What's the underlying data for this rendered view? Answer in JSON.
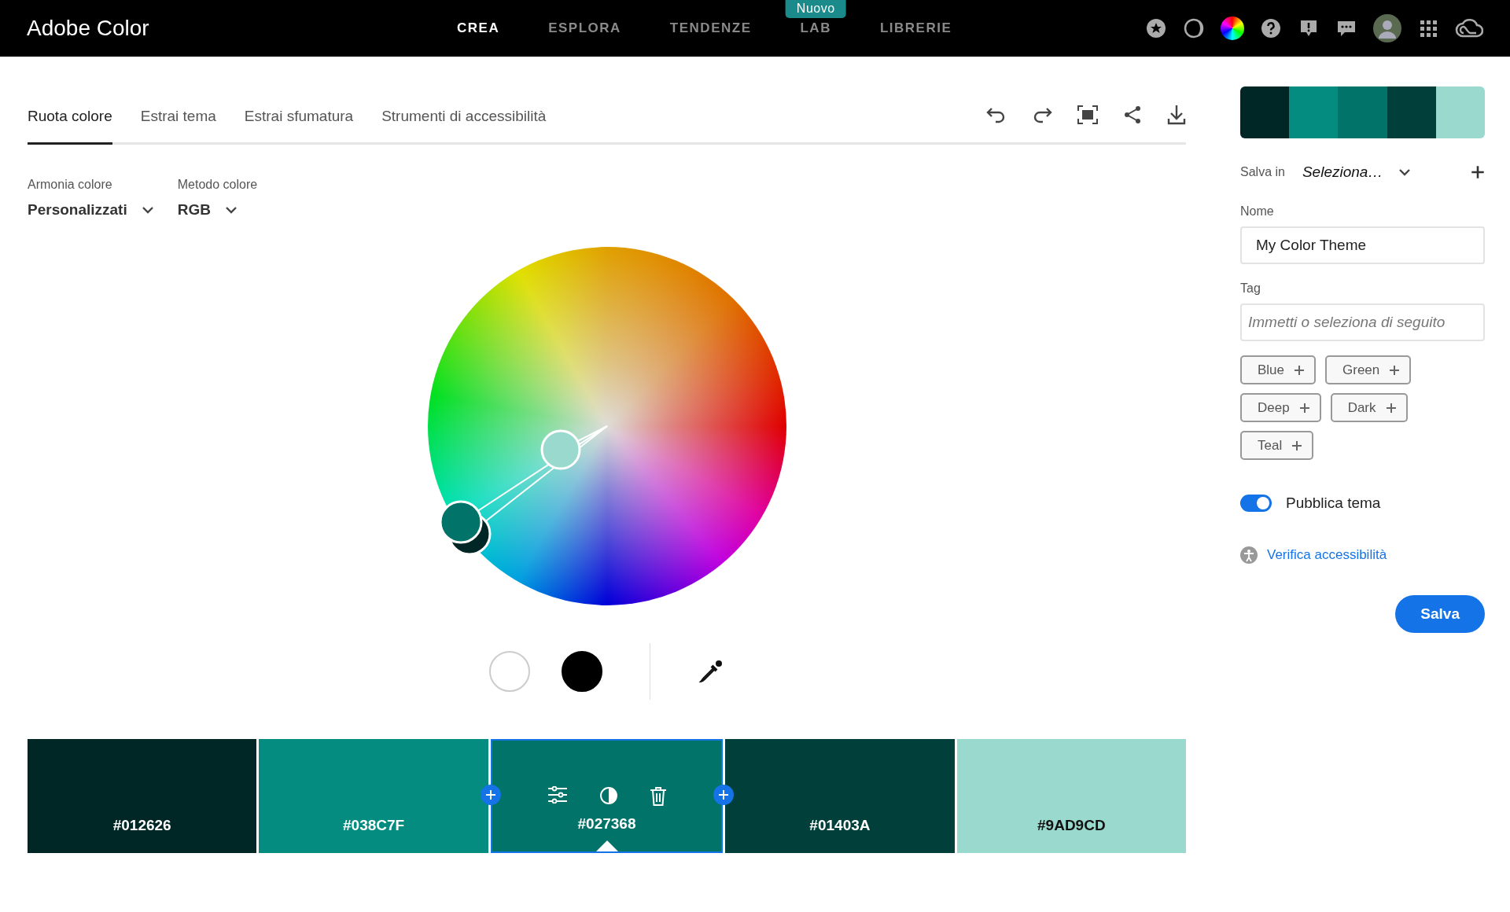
{
  "header": {
    "brand": "Adobe Color",
    "nav": [
      {
        "label": "CREA",
        "selected": true
      },
      {
        "label": "ESPLORA",
        "selected": false
      },
      {
        "label": "TENDENZE",
        "selected": false
      },
      {
        "label": "LAB",
        "selected": false,
        "badge": "Nuovo"
      },
      {
        "label": "LIBRERIE",
        "selected": false
      }
    ]
  },
  "tabs": [
    {
      "label": "Ruota colore",
      "selected": true
    },
    {
      "label": "Estrai tema",
      "selected": false
    },
    {
      "label": "Estrai sfumatura",
      "selected": false
    },
    {
      "label": "Strumenti di accessibilità",
      "selected": false
    }
  ],
  "dropdowns": [
    {
      "label": "Armonia colore",
      "value": "Personalizzati"
    },
    {
      "label": "Metodo colore",
      "value": "RGB"
    }
  ],
  "swatches": [
    {
      "hex": "#012626",
      "selected": false
    },
    {
      "hex": "#038C7F",
      "selected": false
    },
    {
      "hex": "#027368",
      "selected": true
    },
    {
      "hex": "#01403A",
      "selected": false
    },
    {
      "hex": "#9AD9CD",
      "selected": false
    }
  ],
  "panel": {
    "save_in": {
      "label": "Salva in",
      "value": "Seleziona…"
    },
    "name": {
      "label": "Nome",
      "value": "My Color Theme"
    },
    "tag": {
      "label": "Tag",
      "placeholder": "Immetti o seleziona di seguito"
    },
    "tags": [
      "Blue",
      "Green",
      "Deep",
      "Dark",
      "Teal"
    ],
    "publish": {
      "label": "Pubblica tema",
      "on": true
    },
    "link": "Verifica accessibilità",
    "button": "Salva"
  }
}
